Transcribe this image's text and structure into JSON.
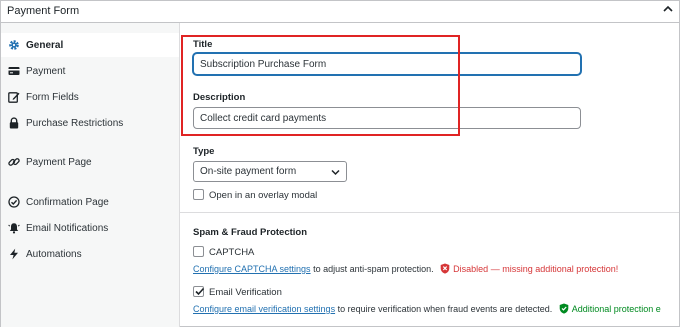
{
  "panel": {
    "title": "Payment Form"
  },
  "sidebar": {
    "items": [
      {
        "label": "General",
        "icon": "gear-icon",
        "active": true
      },
      {
        "label": "Payment",
        "icon": "credit-card-icon"
      },
      {
        "label": "Form Fields",
        "icon": "edit-icon"
      },
      {
        "label": "Purchase Restrictions",
        "icon": "lock-icon"
      },
      {
        "label": "Payment Page",
        "icon": "link-icon"
      },
      {
        "label": "Confirmation Page",
        "icon": "check-circle-icon"
      },
      {
        "label": "Email Notifications",
        "icon": "bell-icon"
      },
      {
        "label": "Automations",
        "icon": "bolt-icon"
      }
    ]
  },
  "general": {
    "title_label": "Title",
    "title_value": "Subscription Purchase Form",
    "description_label": "Description",
    "description_value": "Collect credit card payments",
    "type_label": "Type",
    "type_selected": "On-site payment form",
    "overlay_label": "Open in an overlay modal",
    "overlay_checked": false
  },
  "spam": {
    "heading": "Spam & Fraud Protection",
    "captcha_label": "CAPTCHA",
    "captcha_checked": false,
    "captcha_link": "Configure CAPTCHA settings",
    "captcha_help": "to adjust anti-spam protection.",
    "captcha_status": "Disabled — missing additional protection!",
    "email_label": "Email Verification",
    "email_checked": true,
    "email_link": "Configure email verification settings",
    "email_help": "to require verification when fraud events are detected.",
    "email_status": "Additional protection e"
  },
  "colors": {
    "accent": "#2271b1",
    "highlight": "#e02424",
    "danger": "#d63638",
    "success": "#008a20"
  }
}
